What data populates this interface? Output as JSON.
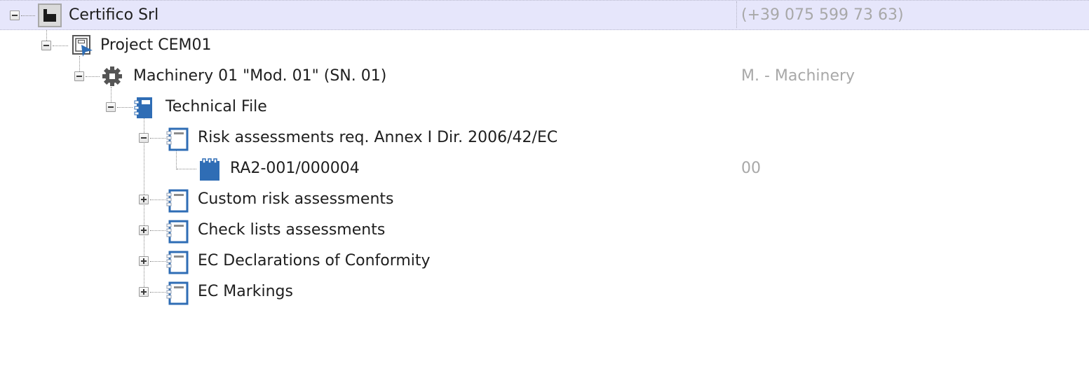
{
  "tree": {
    "nodes": [
      {
        "label": "Certifico Srl",
        "detail": "(+39 075 599 73 63)",
        "icon": "factory-icon",
        "expander": "expanded",
        "selected": true,
        "level": 0
      },
      {
        "label": "Project CEM01",
        "detail": "",
        "icon": "project-icon",
        "expander": "expanded",
        "selected": false,
        "level": 1
      },
      {
        "label": "Machinery 01 \"Mod. 01\" (SN. 01)",
        "detail": "M. - Machinery",
        "icon": "gear-icon",
        "expander": "expanded",
        "selected": false,
        "level": 2
      },
      {
        "label": "Technical File",
        "detail": "",
        "icon": "notebook-filled-icon",
        "expander": "expanded",
        "selected": false,
        "level": 3
      },
      {
        "label": "Risk assessments req. Annex I Dir. 2006/42/EC",
        "detail": "",
        "icon": "notebook-outline-icon",
        "expander": "expanded",
        "selected": false,
        "level": 4
      },
      {
        "label": "RA2-001/000004",
        "detail": "00",
        "icon": "notepad-icon",
        "expander": "none",
        "selected": false,
        "level": 5
      },
      {
        "label": "Custom risk assessments",
        "detail": "",
        "icon": "notebook-outline-icon",
        "expander": "collapsed",
        "selected": false,
        "level": 4
      },
      {
        "label": "Check lists assessments",
        "detail": "",
        "icon": "notebook-outline-icon",
        "expander": "collapsed",
        "selected": false,
        "level": 4
      },
      {
        "label": "EC Declarations of Conformity",
        "detail": "",
        "icon": "notebook-outline-icon",
        "expander": "collapsed",
        "selected": false,
        "level": 4
      },
      {
        "label": "EC Markings",
        "detail": "",
        "icon": "notebook-outline-icon",
        "expander": "collapsed",
        "selected": false,
        "level": 4
      }
    ]
  },
  "colors": {
    "selection_bg": "#e6e6fb",
    "icon_blue": "#2f6db5",
    "icon_gray": "#555555",
    "detail_text": "#a8a8a8"
  }
}
